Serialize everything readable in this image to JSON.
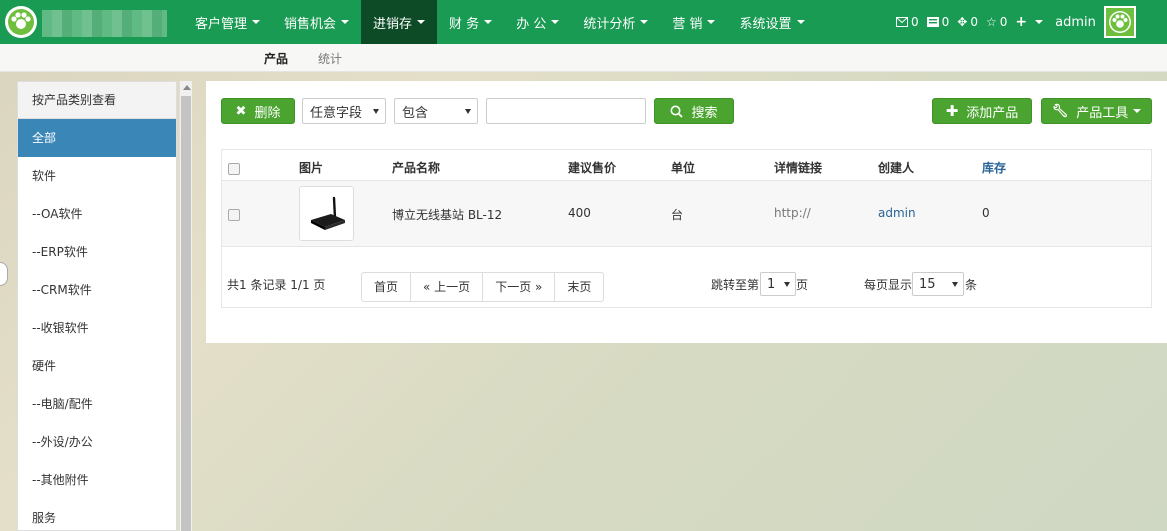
{
  "nav": {
    "items": [
      {
        "label": "客户管理"
      },
      {
        "label": "销售机会"
      },
      {
        "label": "进销存"
      },
      {
        "label": "财 务"
      },
      {
        "label": "办 公"
      },
      {
        "label": "统计分析"
      },
      {
        "label": "营 销"
      },
      {
        "label": "系统设置"
      }
    ],
    "active_index": 2,
    "mail_count": "0",
    "notice_count": "0",
    "task_count": "0",
    "star_count": "0",
    "user": "admin"
  },
  "subnav": {
    "tabs": [
      {
        "label": "产品"
      },
      {
        "label": "统计"
      }
    ]
  },
  "sidebar": {
    "header": "按产品类别查看",
    "items": [
      {
        "label": "全部"
      },
      {
        "label": "软件"
      },
      {
        "label": "--OA软件"
      },
      {
        "label": "--ERP软件"
      },
      {
        "label": "--CRM软件"
      },
      {
        "label": "--收银软件"
      },
      {
        "label": "硬件"
      },
      {
        "label": "--电脑/配件"
      },
      {
        "label": "--外设/办公"
      },
      {
        "label": "--其他附件"
      },
      {
        "label": "服务"
      }
    ]
  },
  "toolbar": {
    "delete_label": "删除",
    "field_select": "任意字段",
    "condition_select": "包含",
    "search_value": "",
    "search_label": "搜索",
    "add_label": "添加产品",
    "tools_label": "产品工具"
  },
  "table": {
    "columns": [
      "图片",
      "产品名称",
      "建议售价",
      "单位",
      "详情链接",
      "创建人",
      "库存"
    ],
    "rows": [
      {
        "name": "博立无线基站 BL-12",
        "price": "400",
        "unit": "台",
        "link": "http://",
        "creator": "admin",
        "stock": "0"
      }
    ]
  },
  "pagination": {
    "summary": "共1 条记录 1/1 页",
    "first": "首页",
    "prev": "« 上一页",
    "next": "下一页 »",
    "last": "末页",
    "jump_prefix": "跳转至第",
    "jump_value": "1",
    "jump_suffix": "页",
    "per_page_prefix": "每页显示",
    "per_page_value": "15",
    "per_page_suffix": "条"
  },
  "colors": {
    "nav_bg": "#1a9b53",
    "nav_active": "#0d4a26",
    "button_green": "#4aa42f",
    "sidebar_active": "#3a86b7",
    "link_blue": "#2a6496"
  }
}
